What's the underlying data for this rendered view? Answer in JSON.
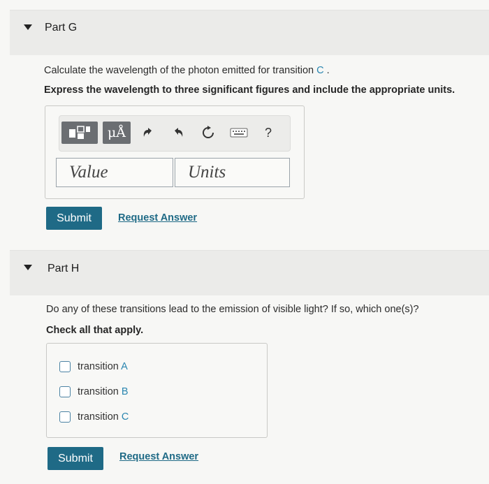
{
  "part_g": {
    "title": "Part G",
    "question": "Calculate the wavelength of the photon emitted for transition ",
    "question_ref": "C",
    "question_end": " .",
    "instruction": "Express the wavelength to three significant figures and include the appropriate units.",
    "toolbar": {
      "units_symbol": "μÅ",
      "help_symbol": "?",
      "icons": [
        "templates-icon",
        "units-icon",
        "undo-icon",
        "redo-icon",
        "reset-icon",
        "keyboard-icon",
        "help-icon"
      ]
    },
    "value_placeholder": "Value",
    "units_placeholder": "Units",
    "submit_label": "Submit",
    "request_label": "Request Answer"
  },
  "part_h": {
    "title": "Part H",
    "question": "Do any of these transitions lead to the emission of visible light? If so, which one(s)?",
    "instruction": "Check all that apply.",
    "options": [
      {
        "prefix": "transition ",
        "letter": "A"
      },
      {
        "prefix": "transition ",
        "letter": "B"
      },
      {
        "prefix": "transition ",
        "letter": "C"
      }
    ],
    "submit_label": "Submit",
    "request_label": "Request Answer"
  },
  "colors": {
    "accent": "#1f6a86",
    "link": "#2a86b0",
    "header_bg": "#ebebe9"
  }
}
